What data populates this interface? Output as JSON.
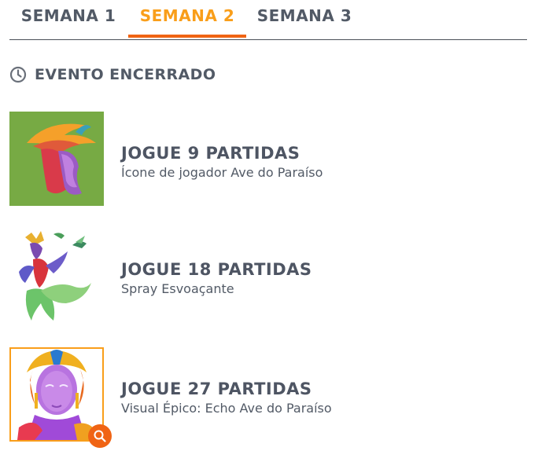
{
  "tabs": [
    {
      "label": "SEMANA 1"
    },
    {
      "label": "SEMANA 2"
    },
    {
      "label": "SEMANA 3"
    }
  ],
  "active_tab_index": 1,
  "status": {
    "icon": "clock-icon",
    "text": "EVENTO ENCERRADO"
  },
  "rewards": [
    {
      "title": "JOGUE 9 PARTIDAS",
      "subtitle": "Ícone de jogador Ave do Paraíso"
    },
    {
      "title": "JOGUE 18 PARTIDAS",
      "subtitle": "Spray Esvoaçante"
    },
    {
      "title": "JOGUE 27 PARTIDAS",
      "subtitle": "Visual Épico: Echo Ave do Paraíso"
    }
  ],
  "colors": {
    "accent": "#f99e1a",
    "accent_dark": "#f06414",
    "text": "#525a66"
  }
}
